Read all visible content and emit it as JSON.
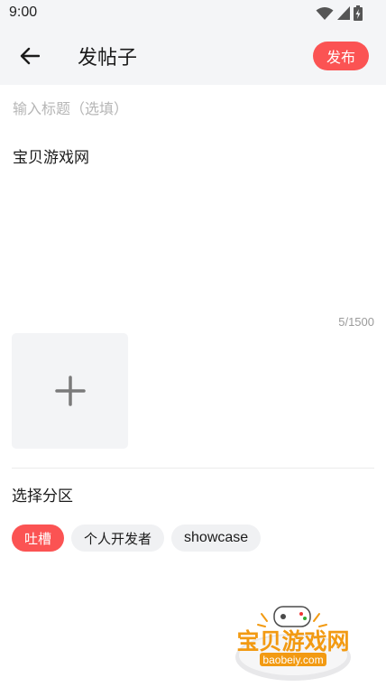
{
  "status_bar": {
    "time": "9:00",
    "icons": [
      "wifi-icon",
      "signal-icon",
      "battery-charging-icon"
    ]
  },
  "header": {
    "back_icon": "arrow-left-icon",
    "title": "发帖子",
    "publish_label": "发布"
  },
  "editor": {
    "title_placeholder": "输入标题（选填）",
    "title_value": "",
    "content": "宝贝游戏网",
    "char_count": "5/1500",
    "add_image_icon": "plus-icon"
  },
  "section": {
    "label": "选择分区",
    "chips": [
      {
        "label": "吐槽",
        "selected": true
      },
      {
        "label": "个人开发者",
        "selected": false
      },
      {
        "label": "showcase",
        "selected": false
      }
    ]
  },
  "watermark": {
    "text": "宝贝游戏网",
    "url": "baobeiy.com"
  },
  "colors": {
    "accent": "#fb5353",
    "header_bg": "#f4f5f7",
    "chip_bg": "#f0f1f3",
    "watermark": "#f29a12"
  }
}
